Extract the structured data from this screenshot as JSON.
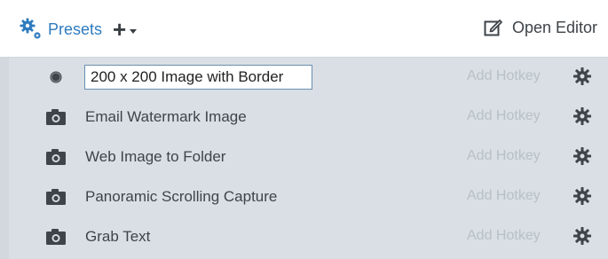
{
  "header": {
    "presets_label": "Presets",
    "add_label": "+",
    "open_editor_label": "Open Editor",
    "accent": "#2f7bbf"
  },
  "rows": [
    {
      "icon": "radio-selected-icon",
      "label": "200 x 200 Image with Border",
      "editing": true,
      "hotkey": "Add Hotkey",
      "settings_icon": "gear-icon"
    },
    {
      "icon": "camera-icon",
      "label": "Email Watermark Image",
      "editing": false,
      "hotkey": "Add Hotkey",
      "settings_icon": "gear-icon"
    },
    {
      "icon": "camera-icon",
      "label": "Web Image to Folder",
      "editing": false,
      "hotkey": "Add Hotkey",
      "settings_icon": "gear-icon"
    },
    {
      "icon": "camera-icon",
      "label": "Panoramic Scrolling Capture",
      "editing": false,
      "hotkey": "Add Hotkey",
      "settings_icon": "gear-icon"
    },
    {
      "icon": "camera-icon",
      "label": "Grab Text",
      "editing": false,
      "hotkey": "Add Hotkey",
      "settings_icon": "gear-icon"
    }
  ]
}
